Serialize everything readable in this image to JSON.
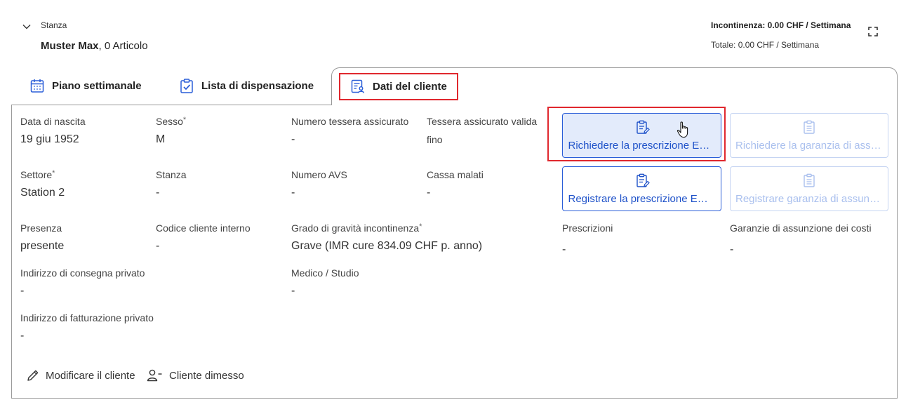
{
  "header": {
    "room_label": "Stanza",
    "client_name": "Muster Max",
    "client_suffix": ", 0 Articolo",
    "incontinence": "Incontinenza: 0.00 CHF / Settimana",
    "total": "Totale: 0.00 CHF / Settimana"
  },
  "tabs": [
    {
      "label": "Piano settimanale",
      "icon": "calendar-icon",
      "active": false
    },
    {
      "label": "Lista di dispensazione",
      "icon": "clipboard-check-icon",
      "active": false
    },
    {
      "label": "Dati del cliente",
      "icon": "client-data-icon",
      "active": true
    }
  ],
  "fields": {
    "birth": {
      "label": "Data di nascita",
      "value": "19 giu 1952"
    },
    "sex": {
      "label": "Sesso",
      "value": "M"
    },
    "card_number": {
      "label": "Numero tessera assicurato",
      "value": "-"
    },
    "card_valid": {
      "label": "Tessera assicurato valida",
      "value": "fino"
    },
    "sector": {
      "label": "Settore",
      "value": "Station 2"
    },
    "room": {
      "label": "Stanza",
      "value": "-"
    },
    "avs": {
      "label": "Numero AVS",
      "value": "-"
    },
    "insurer": {
      "label": "Cassa malati",
      "value": "-"
    },
    "presence": {
      "label": "Presenza",
      "value": "presente"
    },
    "internal_code": {
      "label": "Codice cliente interno",
      "value": "-"
    },
    "severity": {
      "label": "Grado di gravità incontinenza",
      "value": "Grave (IMR cure 834.09 CHF p. anno)"
    },
    "prescriptions": {
      "label": "Prescrizioni",
      "value": "-"
    },
    "guarantees": {
      "label": "Garanzie di assunzione dei costi",
      "value": "-"
    },
    "delivery_address": {
      "label": "Indirizzo di consegna privato",
      "value": "-"
    },
    "doctor": {
      "label": "Medico / Studio",
      "value": "-"
    },
    "billing_address": {
      "label": "Indirizzo di fatturazione privato",
      "value": "-"
    }
  },
  "required_marker": "*",
  "cards": {
    "request_prescription": "Richiedere la prescrizione EMAP",
    "request_guarantee": "Richiedere la garanzia di assunzione dei costi",
    "register_prescription": "Registrare la prescrizione EMAP",
    "register_guarantee": "Registrare garanzia di assunzione dei costi"
  },
  "actions": {
    "edit": "Modificare il cliente",
    "discharge": "Cliente dimesso"
  },
  "colors": {
    "accent": "#2a5ed8",
    "highlight": "#e0282e",
    "disabled": "#aac0ee"
  }
}
